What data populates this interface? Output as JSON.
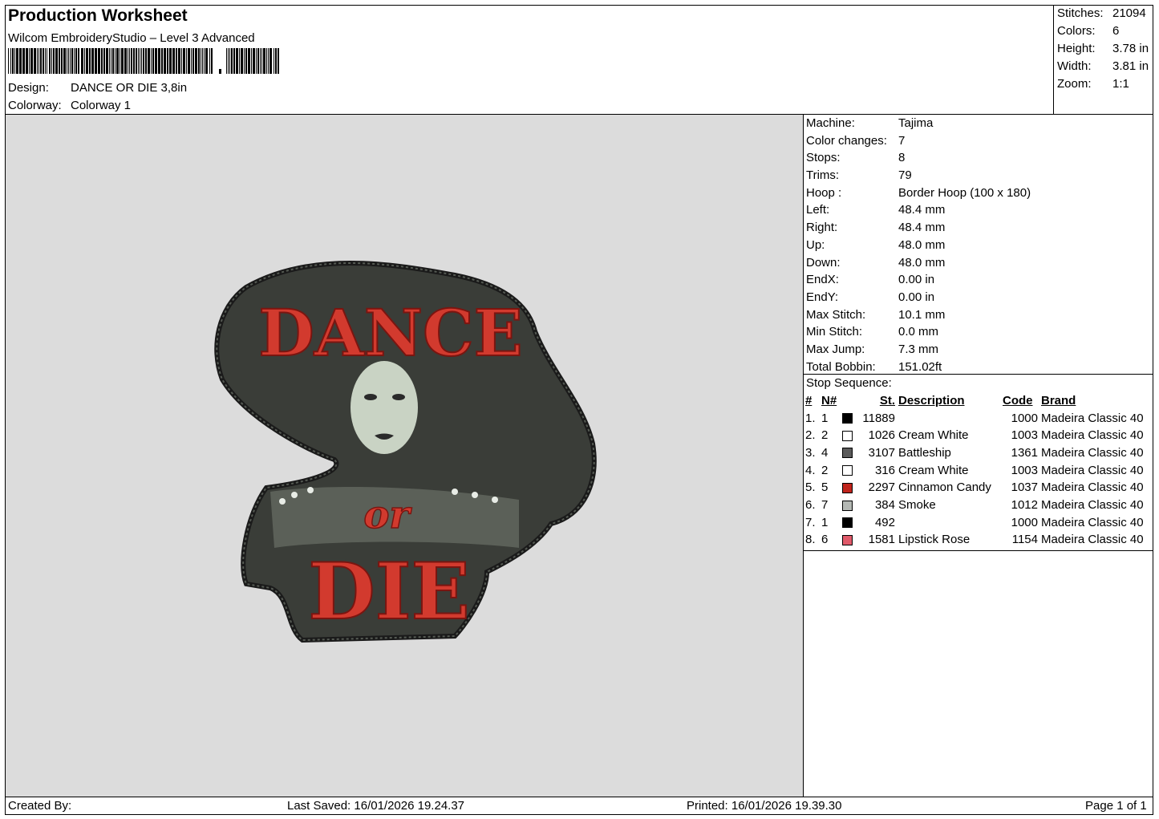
{
  "header": {
    "title": "Production Worksheet",
    "software": "Wilcom EmbroideryStudio – Level 3 Advanced",
    "design_label": "Design:",
    "design_value": "DANCE OR DIE 3,8in",
    "colorway_label": "Colorway:",
    "colorway_value": "Colorway 1"
  },
  "stats": [
    {
      "label": "Stitches:",
      "value": "21094"
    },
    {
      "label": "Colors:",
      "value": "6"
    },
    {
      "label": "Height:",
      "value": "3.78 in"
    },
    {
      "label": "Width:",
      "value": "3.81 in"
    },
    {
      "label": "Zoom:",
      "value": "1:1"
    }
  ],
  "machine_props": [
    {
      "label": "Machine:",
      "value": "Tajima"
    },
    {
      "label": "Color changes:",
      "value": "7"
    },
    {
      "label": "Stops:",
      "value": "8"
    },
    {
      "label": "Trims:",
      "value": "79"
    },
    {
      "label": "Hoop :",
      "value": "Border Hoop (100 x 180)"
    },
    {
      "label": "Left:",
      "value": "48.4 mm"
    },
    {
      "label": "Right:",
      "value": "48.4 mm"
    },
    {
      "label": "Up:",
      "value": "48.0 mm"
    },
    {
      "label": "Down:",
      "value": "48.0 mm"
    },
    {
      "label": "EndX:",
      "value": "0.00 in"
    },
    {
      "label": "EndY:",
      "value": "0.00 in"
    },
    {
      "label": "Max Stitch:",
      "value": "10.1 mm"
    },
    {
      "label": "Min Stitch:",
      "value": "0.0 mm"
    },
    {
      "label": "Max Jump:",
      "value": "7.3 mm"
    },
    {
      "label": "Total Bobbin:",
      "value": "151.02ft"
    }
  ],
  "stop_sequence": {
    "title": "Stop Sequence:",
    "columns": {
      "num": "#",
      "n": "N#",
      "st": "St.",
      "desc": "Description",
      "code": "Code",
      "brand": "Brand"
    },
    "rows": [
      {
        "num": "1.",
        "n": "1",
        "color": "#000000",
        "st": "11889",
        "desc": "",
        "code": "1000",
        "brand": "Madeira Classic 40"
      },
      {
        "num": "2.",
        "n": "2",
        "color": "#ffffff",
        "st": "1026",
        "desc": "Cream White",
        "code": "1003",
        "brand": "Madeira Classic 40"
      },
      {
        "num": "3.",
        "n": "4",
        "color": "#5a5a5a",
        "st": "3107",
        "desc": "Battleship",
        "code": "1361",
        "brand": "Madeira Classic 40"
      },
      {
        "num": "4.",
        "n": "2",
        "color": "#ffffff",
        "st": "316",
        "desc": "Cream White",
        "code": "1003",
        "brand": "Madeira Classic 40"
      },
      {
        "num": "5.",
        "n": "5",
        "color": "#c0241c",
        "st": "2297",
        "desc": "Cinnamon Candy",
        "code": "1037",
        "brand": "Madeira Classic 40"
      },
      {
        "num": "6.",
        "n": "7",
        "color": "#b4b8b4",
        "st": "384",
        "desc": "Smoke",
        "code": "1012",
        "brand": "Madeira Classic 40"
      },
      {
        "num": "7.",
        "n": "1",
        "color": "#000000",
        "st": "492",
        "desc": "",
        "code": "1000",
        "brand": "Madeira Classic 40"
      },
      {
        "num": "8.",
        "n": "6",
        "color": "#e05a6a",
        "st": "1581",
        "desc": "Lipstick Rose",
        "code": "1154",
        "brand": "Madeira Classic 40"
      }
    ]
  },
  "patch": {
    "line1": "DANCE",
    "line2": "or",
    "line3": "DIE"
  },
  "footer": {
    "created_by": "Created By:",
    "last_saved": "Last Saved: 16/01/2026 19.24.37",
    "printed": "Printed: 16/01/2026 19.39.30",
    "page": "Page 1 of 1"
  }
}
